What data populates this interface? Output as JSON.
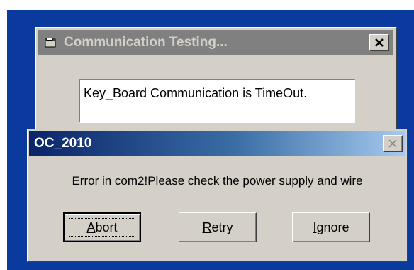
{
  "background_window": {
    "title": "Communication Testing...",
    "message": "Key_Board Communication is TimeOut."
  },
  "dialog": {
    "title": "OC_2010",
    "message": "Error in com2!Please check the power supply and wire",
    "buttons": [
      {
        "label": "Abort",
        "mnemonic": "A",
        "rest": "bort",
        "default": true
      },
      {
        "label": "Retry",
        "mnemonic": "R",
        "rest": "etry",
        "default": false
      },
      {
        "label": "Ignore",
        "mnemonic": "I",
        "rest": "gnore",
        "default": false
      }
    ]
  },
  "colors": {
    "desktop": "#0b3a9e",
    "face": "#d4d0c8",
    "active_title": "#0a246a",
    "inactive_title": "#808080"
  }
}
